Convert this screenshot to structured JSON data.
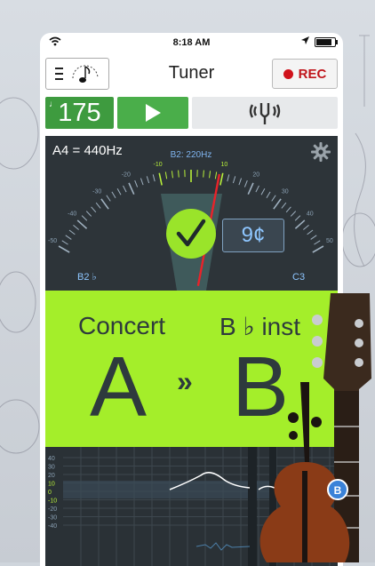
{
  "status": {
    "time": "8:18 AM"
  },
  "header": {
    "title": "Tuner",
    "rec_label": "REC"
  },
  "controls": {
    "tempo": "175"
  },
  "meter": {
    "reference": "A4 = 440Hz",
    "target_freq": "B2: 220Hz",
    "left_note": "B2 ♭",
    "right_note": "C3",
    "cents": "9¢",
    "needle_cents": 9
  },
  "transpose": {
    "left_label": "Concert",
    "left_note": "A",
    "arrow": "»",
    "right_label": "B ♭ inst",
    "right_note": "B"
  },
  "graph": {
    "y_labels": [
      "40",
      "30",
      "20",
      "10",
      "0",
      "-10",
      "-20",
      "-30",
      "-40"
    ]
  },
  "badge": "B",
  "colors": {
    "accent_green": "#a4ee2a",
    "play_green": "#4aae4a",
    "rec_red": "#d0121b",
    "panel_dark": "#2d3439"
  }
}
